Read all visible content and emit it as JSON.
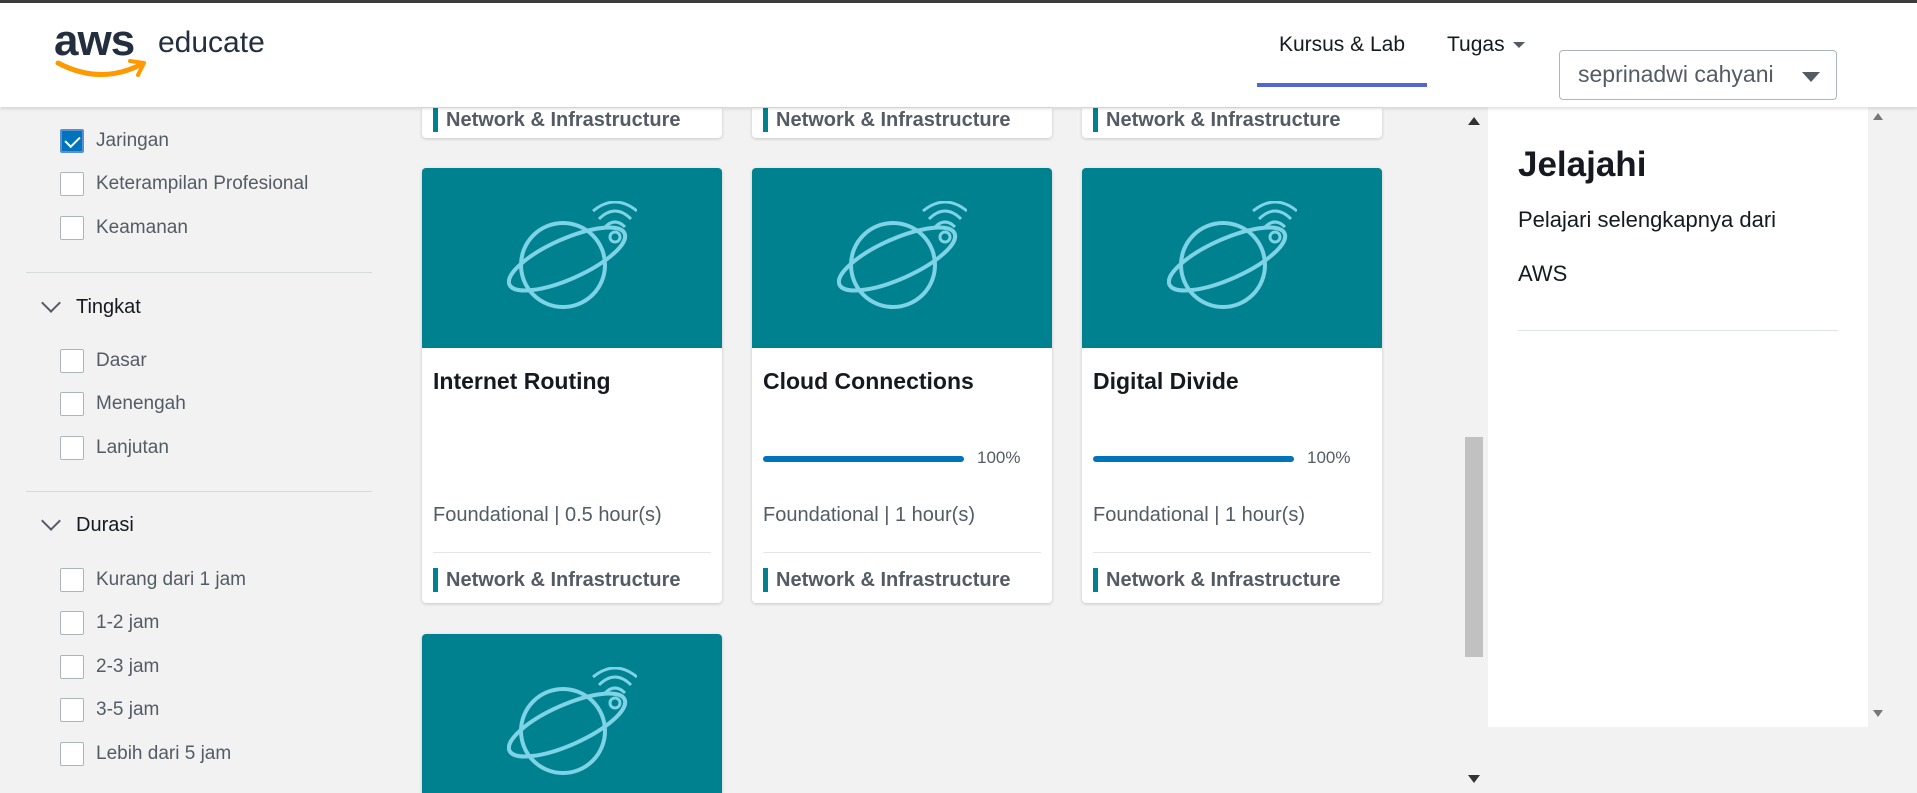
{
  "header": {
    "logo_aws": "aws",
    "logo_educate": "educate",
    "nav": [
      {
        "label": "Kursus & Lab",
        "active": true
      },
      {
        "label": "Tugas",
        "has_dropdown": true
      }
    ],
    "user": "seprinadwi cahyani"
  },
  "sidebar": {
    "topic_items": [
      {
        "label": "Jaringan",
        "checked": true
      },
      {
        "label": "Keterampilan Profesional",
        "checked": false
      },
      {
        "label": "Keamanan",
        "checked": false
      }
    ],
    "level": {
      "title": "Tingkat",
      "items": [
        {
          "label": "Dasar",
          "checked": false
        },
        {
          "label": "Menengah",
          "checked": false
        },
        {
          "label": "Lanjutan",
          "checked": false
        }
      ]
    },
    "duration": {
      "title": "Durasi",
      "items": [
        {
          "label": "Kurang dari 1 jam",
          "checked": false
        },
        {
          "label": "1-2 jam",
          "checked": false
        },
        {
          "label": "2-3 jam",
          "checked": false
        },
        {
          "label": "3-5 jam",
          "checked": false
        },
        {
          "label": "Lebih dari 5 jam",
          "checked": false
        }
      ]
    }
  },
  "partial_cards": [
    {
      "category": "Network & Infrastructure"
    },
    {
      "category": "Network & Infrastructure"
    },
    {
      "category": "Network & Infrastructure"
    }
  ],
  "cards": [
    {
      "title": "Internet Routing",
      "meta": "Foundational | 0.5 hour(s)",
      "category": "Network & Infrastructure",
      "progress": null,
      "progress_label": ""
    },
    {
      "title": "Cloud Connections",
      "meta": "Foundational | 1 hour(s)",
      "category": "Network & Infrastructure",
      "progress": 1.0,
      "progress_label": "100%"
    },
    {
      "title": "Digital Divide",
      "meta": "Foundational | 1 hour(s)",
      "category": "Network & Infrastructure",
      "progress": 1.0,
      "progress_label": "100%"
    }
  ],
  "explore": {
    "title": "Jelajahi",
    "description": "Pelajari selengkapnya dari",
    "link": "AWS"
  },
  "colors": {
    "accent": "#00818f",
    "progress": "#0073bb",
    "nav_active": "#5167d6"
  },
  "icons": {
    "card_image": "globe-wifi-icon",
    "checkbox_checked": "check-icon",
    "section_toggle": "chevron-down-icon"
  }
}
